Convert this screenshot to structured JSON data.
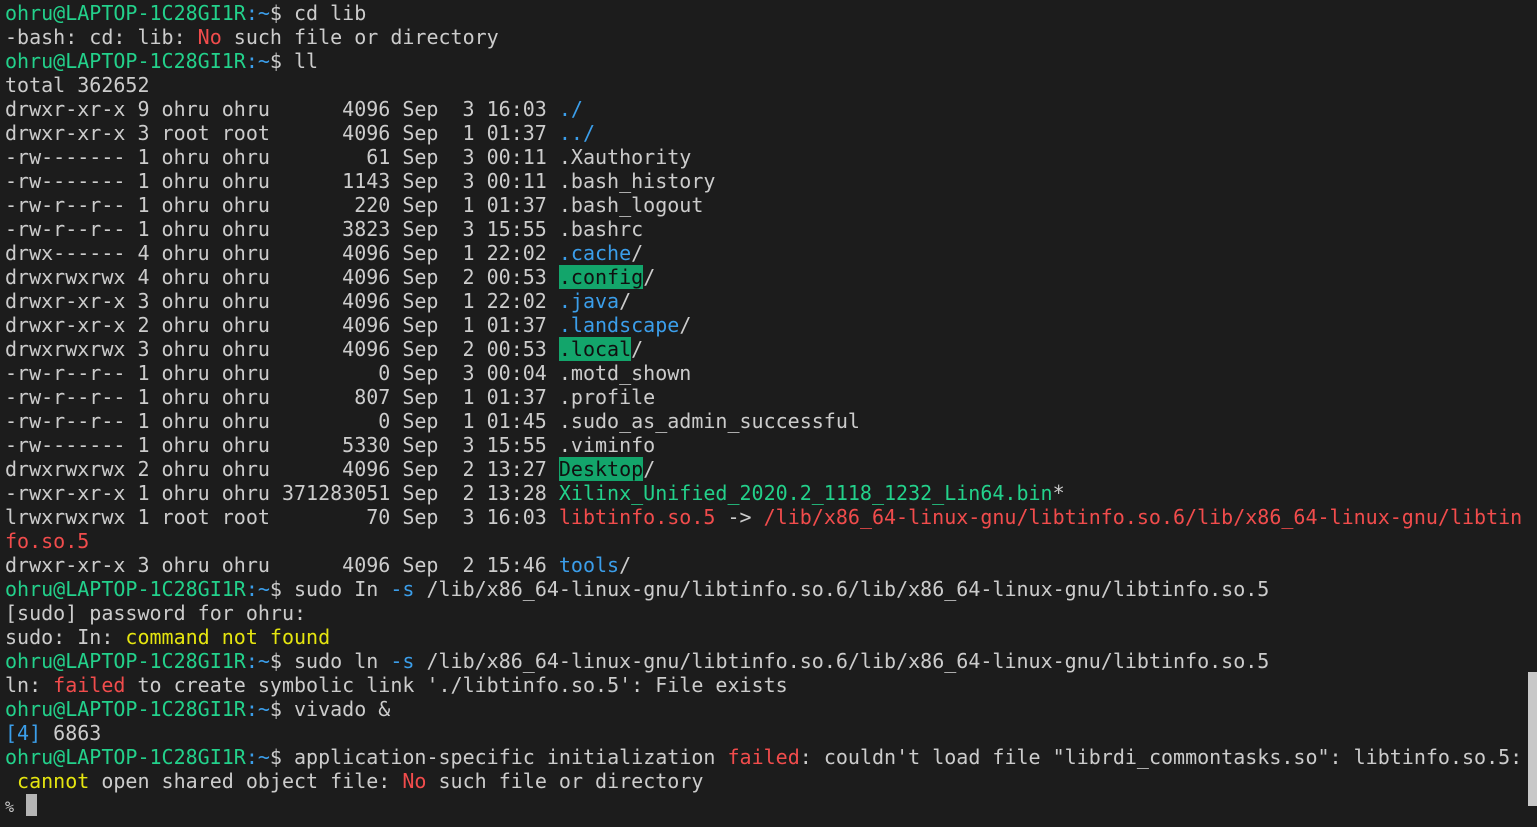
{
  "colors": {
    "background": "#1c1c1c",
    "prompt": "#23d18b",
    "blue": "#3b9eea",
    "red": "#f14c4c",
    "yellow": "#e5e510",
    "highlight": "#13a56b"
  },
  "prompt": {
    "user_host": "ohru@LAPTOP-1C28GI1R",
    "path": ":~",
    "symbol": "$ "
  },
  "lines": [
    {
      "prompt": true,
      "segs": [
        {
          "t": "cd lib",
          "c": "w"
        }
      ]
    },
    {
      "segs": [
        {
          "t": "-bash: cd: lib: ",
          "c": "w"
        },
        {
          "t": "No",
          "c": "r"
        },
        {
          "t": " such file or directory",
          "c": "w"
        }
      ]
    },
    {
      "prompt": true,
      "segs": [
        {
          "t": "ll",
          "c": "w"
        }
      ]
    },
    {
      "segs": [
        {
          "t": "total 362652",
          "c": "w"
        }
      ]
    },
    {
      "segs": [
        {
          "t": "drwxr-xr-x 9 ohru ohru      4096 Sep  3 16:03 ",
          "c": "w"
        },
        {
          "t": "./",
          "c": "b"
        }
      ]
    },
    {
      "segs": [
        {
          "t": "drwxr-xr-x 3 root root      4096 Sep  1 01:37 ",
          "c": "w"
        },
        {
          "t": "../",
          "c": "b"
        }
      ]
    },
    {
      "segs": [
        {
          "t": "-rw------- 1 ohru ohru        61 Sep  3 00:11 .Xauthority",
          "c": "w"
        }
      ]
    },
    {
      "segs": [
        {
          "t": "-rw------- 1 ohru ohru      1143 Sep  3 00:11 .bash_history",
          "c": "w"
        }
      ]
    },
    {
      "segs": [
        {
          "t": "-rw-r--r-- 1 ohru ohru       220 Sep  1 01:37 .bash_logout",
          "c": "w"
        }
      ]
    },
    {
      "segs": [
        {
          "t": "-rw-r--r-- 1 ohru ohru      3823 Sep  3 15:55 .bashrc",
          "c": "w"
        }
      ]
    },
    {
      "segs": [
        {
          "t": "drwx------ 4 ohru ohru      4096 Sep  1 22:02 ",
          "c": "w"
        },
        {
          "t": ".cache",
          "c": "b"
        },
        {
          "t": "/",
          "c": "w"
        }
      ]
    },
    {
      "segs": [
        {
          "t": "drwxrwxrwx 4 ohru ohru      4096 Sep  2 00:53 ",
          "c": "w"
        },
        {
          "t": ".config",
          "c": "hl"
        },
        {
          "t": "/",
          "c": "w"
        }
      ]
    },
    {
      "segs": [
        {
          "t": "drwxr-xr-x 3 ohru ohru      4096 Sep  1 22:02 ",
          "c": "w"
        },
        {
          "t": ".java",
          "c": "b"
        },
        {
          "t": "/",
          "c": "w"
        }
      ]
    },
    {
      "segs": [
        {
          "t": "drwxr-xr-x 2 ohru ohru      4096 Sep  1 01:37 ",
          "c": "w"
        },
        {
          "t": ".landscape",
          "c": "b"
        },
        {
          "t": "/",
          "c": "w"
        }
      ]
    },
    {
      "segs": [
        {
          "t": "drwxrwxrwx 3 ohru ohru      4096 Sep  2 00:53 ",
          "c": "w"
        },
        {
          "t": ".local",
          "c": "hl"
        },
        {
          "t": "/",
          "c": "w"
        }
      ]
    },
    {
      "segs": [
        {
          "t": "-rw-r--r-- 1 ohru ohru         0 Sep  3 00:04 .motd_shown",
          "c": "w"
        }
      ]
    },
    {
      "segs": [
        {
          "t": "-rw-r--r-- 1 ohru ohru       807 Sep  1 01:37 .profile",
          "c": "w"
        }
      ]
    },
    {
      "segs": [
        {
          "t": "-rw-r--r-- 1 ohru ohru         0 Sep  1 01:45 .sudo_as_admin_successful",
          "c": "w"
        }
      ]
    },
    {
      "segs": [
        {
          "t": "-rw------- 1 ohru ohru      5330 Sep  3 15:55 .viminfo",
          "c": "w"
        }
      ]
    },
    {
      "segs": [
        {
          "t": "drwxrwxrwx 2 ohru ohru      4096 Sep  2 13:27 ",
          "c": "w"
        },
        {
          "t": "Desktop",
          "c": "hl"
        },
        {
          "t": "/",
          "c": "w"
        }
      ]
    },
    {
      "segs": [
        {
          "t": "-rwxr-xr-x 1 ohru ohru 371283051 Sep  2 13:28 ",
          "c": "w"
        },
        {
          "t": "Xilinx_Unified_2020.2_1118_1232_Lin64.bin",
          "c": "x"
        },
        {
          "t": "*",
          "c": "w"
        }
      ]
    },
    {
      "segs": [
        {
          "t": "lrwxrwxrwx 1 root root        70 Sep  3 16:03 ",
          "c": "w"
        },
        {
          "t": "libtinfo.so.5",
          "c": "r"
        },
        {
          "t": " -> ",
          "c": "w"
        },
        {
          "t": "/lib/x86_64-linux-gnu/libtinfo.so.6/lib/x86_64-linux-gnu/libtin",
          "c": "r"
        }
      ]
    },
    {
      "segs": [
        {
          "t": "fo.so.5",
          "c": "r"
        }
      ]
    },
    {
      "segs": [
        {
          "t": "drwxr-xr-x 3 ohru ohru      4096 Sep  2 15:46 ",
          "c": "w"
        },
        {
          "t": "tools",
          "c": "b"
        },
        {
          "t": "/",
          "c": "w"
        }
      ]
    },
    {
      "prompt": true,
      "segs": [
        {
          "t": "sudo In ",
          "c": "w"
        },
        {
          "t": "-s",
          "c": "b"
        },
        {
          "t": " /lib/x86_64-linux-gnu/libtinfo.so.6/lib/x86_64-linux-gnu/libtinfo.so.5",
          "c": "w"
        }
      ]
    },
    {
      "segs": [
        {
          "t": "[sudo] password for ohru:",
          "c": "w"
        }
      ]
    },
    {
      "segs": [
        {
          "t": "sudo: In: ",
          "c": "w"
        },
        {
          "t": "command not found",
          "c": "y"
        }
      ]
    },
    {
      "prompt": true,
      "segs": [
        {
          "t": "sudo ln ",
          "c": "w"
        },
        {
          "t": "-s",
          "c": "b"
        },
        {
          "t": " /lib/x86_64-linux-gnu/libtinfo.so.6/lib/x86_64-linux-gnu/libtinfo.so.5",
          "c": "w"
        }
      ]
    },
    {
      "segs": [
        {
          "t": "ln: ",
          "c": "w"
        },
        {
          "t": "failed",
          "c": "r"
        },
        {
          "t": " to create symbolic link './libtinfo.so.5': File exists",
          "c": "w"
        }
      ]
    },
    {
      "prompt": true,
      "segs": [
        {
          "t": "vivado &",
          "c": "w"
        }
      ]
    },
    {
      "segs": [
        {
          "t": "[4]",
          "c": "b"
        },
        {
          "t": " 6863",
          "c": "w"
        }
      ]
    },
    {
      "prompt": true,
      "segs": [
        {
          "t": "application-specific initialization ",
          "c": "w"
        },
        {
          "t": "failed",
          "c": "r"
        },
        {
          "t": ": couldn't load file \"librdi_commontasks.so\": libtinfo.so.5:",
          "c": "w"
        }
      ]
    },
    {
      "segs": [
        {
          "t": " ",
          "c": "w"
        },
        {
          "t": "cannot",
          "c": "y"
        },
        {
          "t": " open shared object file: ",
          "c": "w"
        },
        {
          "t": "No",
          "c": "r"
        },
        {
          "t": " such file or directory",
          "c": "w"
        }
      ]
    },
    {
      "cursor": true,
      "segs": [
        {
          "t": "%",
          "c": "pct"
        },
        {
          "t": " ",
          "c": "w"
        }
      ]
    }
  ]
}
